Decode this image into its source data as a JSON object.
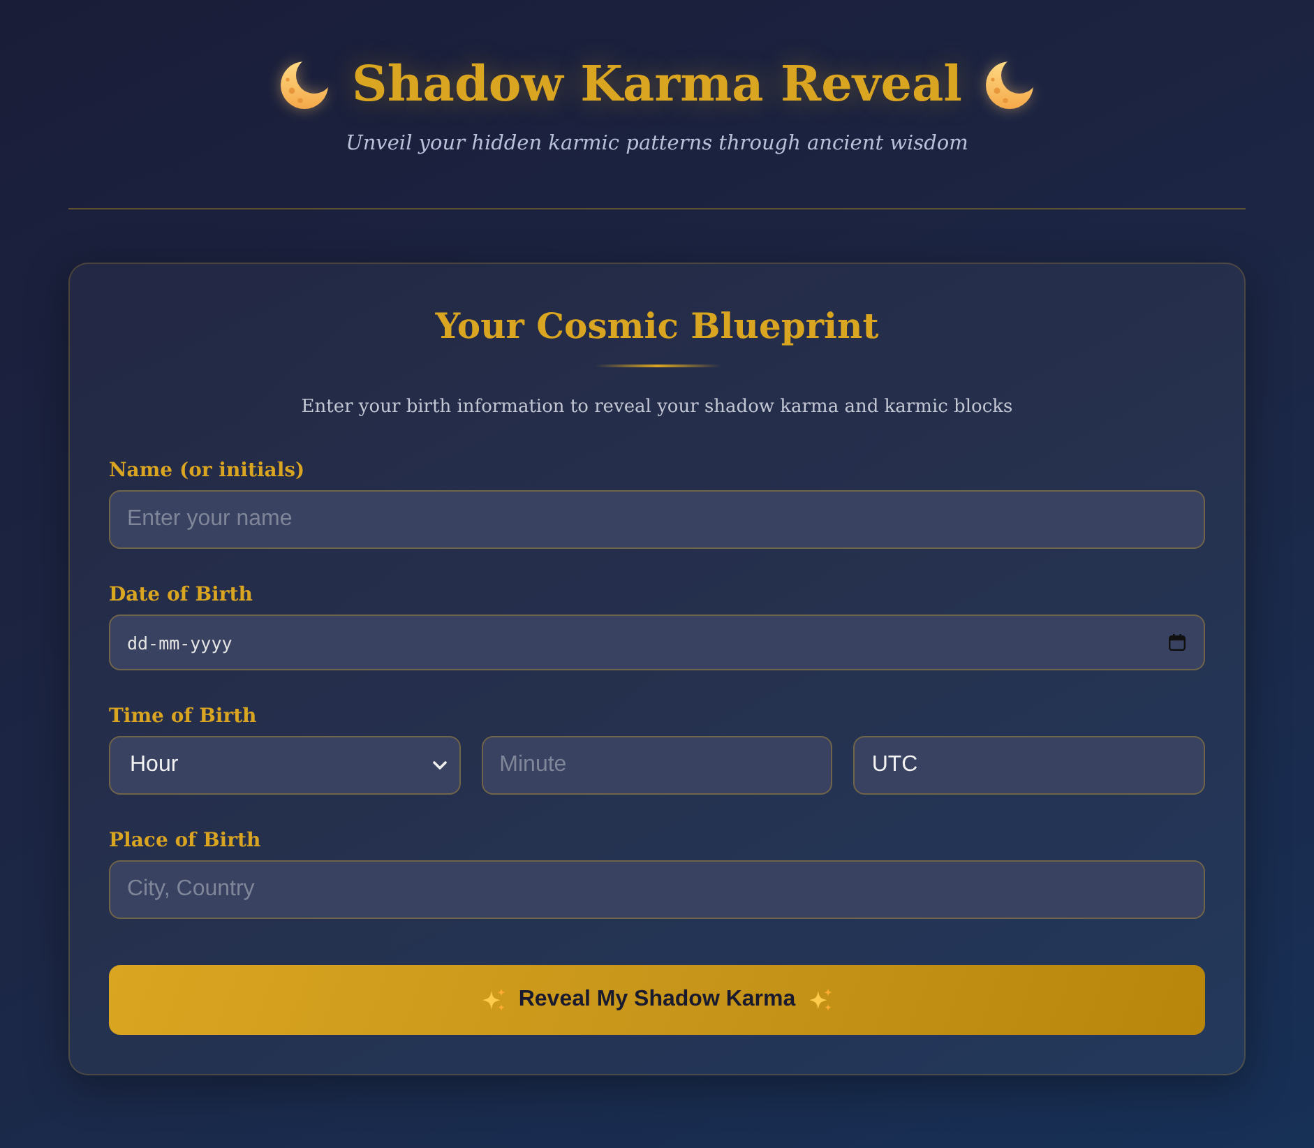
{
  "header": {
    "title": "Shadow Karma Reveal",
    "subtitle": "Unveil your hidden karmic patterns through ancient wisdom"
  },
  "form": {
    "title": "Your Cosmic Blueprint",
    "description": "Enter your birth information to reveal your shadow karma and karmic blocks",
    "fields": [
      {
        "kind": "text",
        "label": "Name (or initials)",
        "placeholder": "Enter your name"
      },
      {
        "kind": "date",
        "label": "Date of Birth",
        "placeholder": "dd-mm-yyyy"
      },
      {
        "kind": "group",
        "label": "Time of Birth",
        "controls": [
          {
            "kind": "select",
            "value": "Hour"
          },
          {
            "kind": "text",
            "placeholder": "Minute"
          },
          {
            "kind": "text",
            "value": "UTC"
          }
        ]
      },
      {
        "kind": "text",
        "label": "Place of Birth",
        "placeholder": "City, Country"
      }
    ],
    "submit_button": {
      "label": "Reveal My Shadow Karma"
    }
  }
}
